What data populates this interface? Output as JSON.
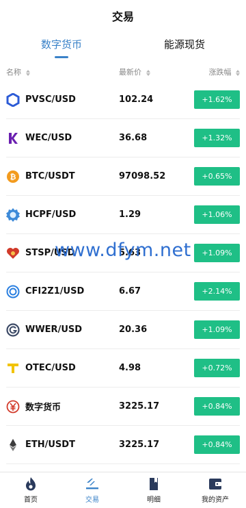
{
  "header": {
    "title": "交易"
  },
  "tabs": [
    {
      "label": "数字货币",
      "active": true
    },
    {
      "label": "能源现货",
      "active": false
    }
  ],
  "columns": {
    "name": "名称",
    "price": "最新价",
    "change": "涨跌幅"
  },
  "rows": [
    {
      "name": "PVSC/USD",
      "price": "102.24",
      "change": "+1.62%",
      "icon": "hexagon-icon"
    },
    {
      "name": "WEC/USD",
      "price": "36.68",
      "change": "+1.32%",
      "icon": "k-logo-icon"
    },
    {
      "name": "BTC/USDT",
      "price": "97098.52",
      "change": "+0.65%",
      "icon": "bitcoin-icon"
    },
    {
      "name": "HCPF/USD",
      "price": "1.29",
      "change": "+1.06%",
      "icon": "gear-badge-icon"
    },
    {
      "name": "STSP/USD",
      "price": "5.63",
      "change": "+1.09%",
      "icon": "heart-icon"
    },
    {
      "name": "CFI2Z1/USD",
      "price": "6.67",
      "change": "+2.14%",
      "icon": "circle-coin-icon"
    },
    {
      "name": "WWER/USD",
      "price": "20.36",
      "change": "+1.09%",
      "icon": "g-ring-icon"
    },
    {
      "name": "OTEC/USD",
      "price": "4.98",
      "change": "+0.72%",
      "icon": "t-logo-icon"
    },
    {
      "name": "数字货币",
      "price": "3225.17",
      "change": "+0.84%",
      "icon": "yen-circle-icon"
    },
    {
      "name": "ETH/USDT",
      "price": "3225.17",
      "change": "+0.84%",
      "icon": "ethereum-icon"
    }
  ],
  "watermark": "www.dfym.net",
  "tabbar": [
    {
      "label": "首页",
      "icon": "flame-icon",
      "active": false
    },
    {
      "label": "交易",
      "icon": "trade-icon",
      "active": true
    },
    {
      "label": "明细",
      "icon": "document-icon",
      "active": false
    },
    {
      "label": "我的资产",
      "icon": "wallet-icon",
      "active": false
    }
  ],
  "colors": {
    "accent": "#3a82c8",
    "rise": "#1fbf86"
  }
}
